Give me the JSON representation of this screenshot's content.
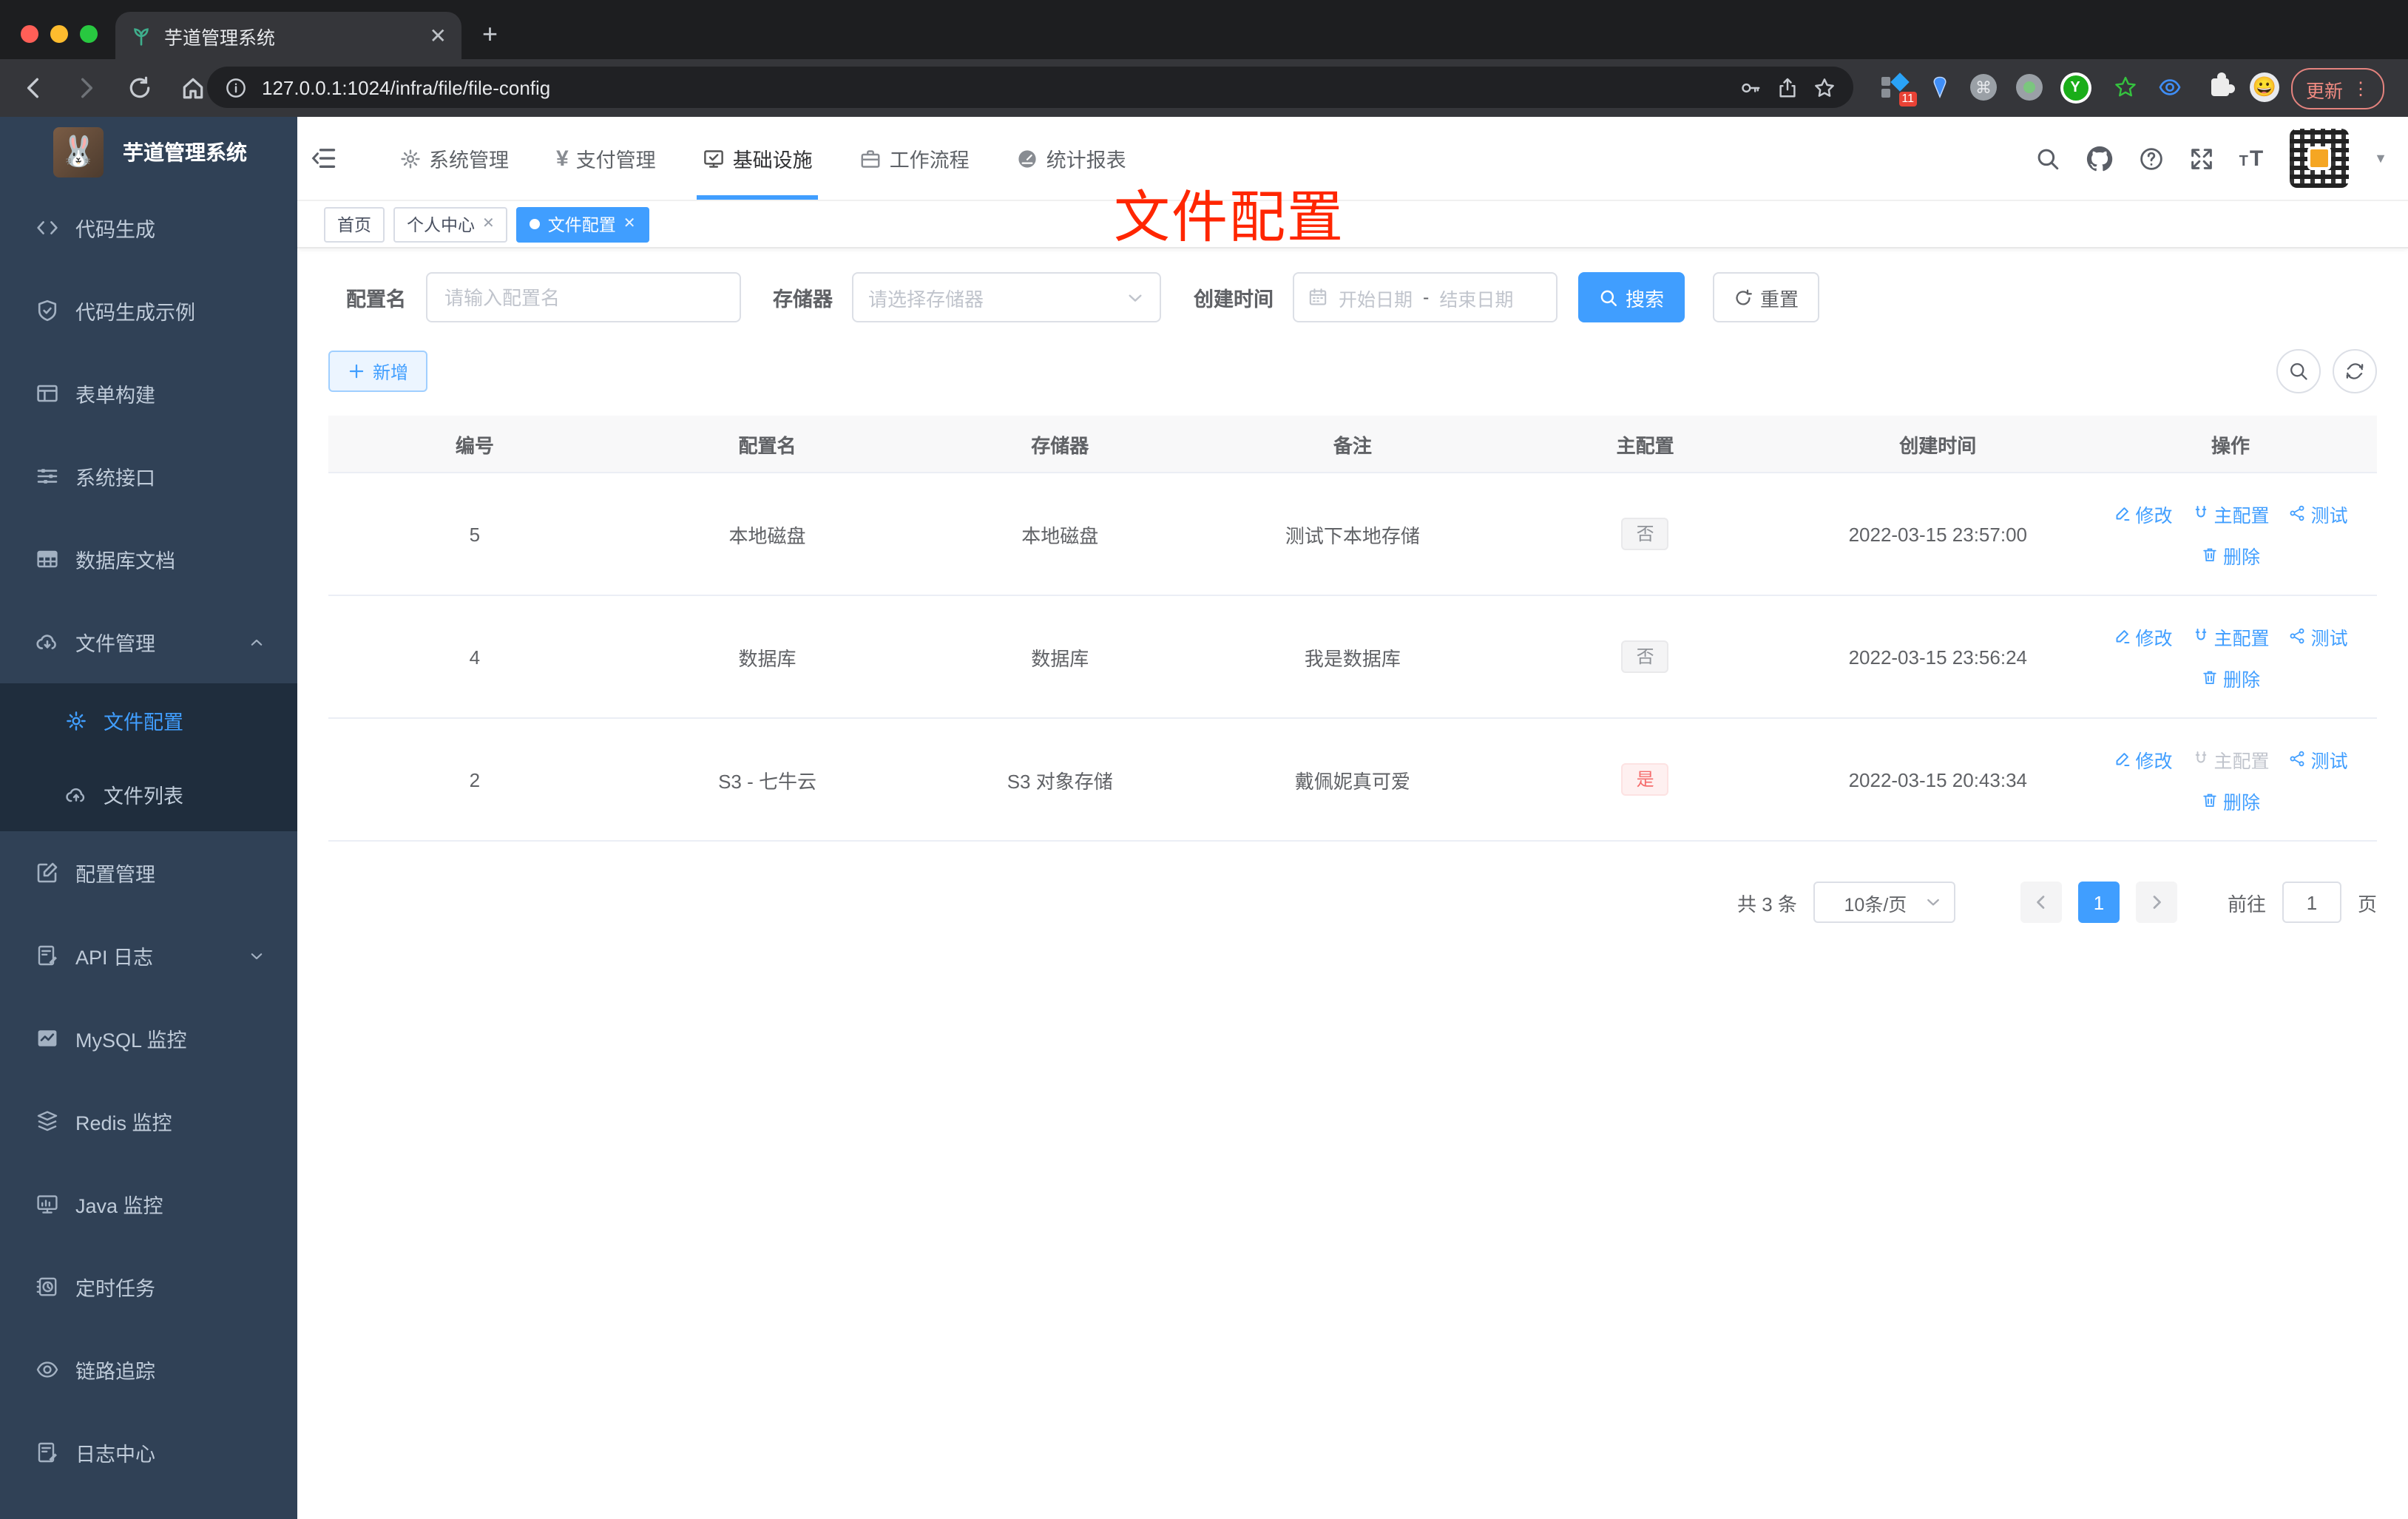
{
  "colors": {
    "accent": "#409eff",
    "danger": "#f56c6c",
    "sidebar_bg": "#304156",
    "sidebar_sub_bg": "#1f2d3d",
    "annotation_red": "#ff2600",
    "tag_active": "#409eff"
  },
  "browser": {
    "tab_title": "芋道管理系统",
    "url": "127.0.0.1:1024/infra/file/file-config",
    "update_label": "更新",
    "extension_badge": "11"
  },
  "sidebar": {
    "app_title": "芋道管理系统",
    "items": [
      {
        "label": "代码生成"
      },
      {
        "label": "代码生成示例"
      },
      {
        "label": "表单构建"
      },
      {
        "label": "系统接口"
      },
      {
        "label": "数据库文档"
      },
      {
        "label": "文件管理"
      },
      {
        "label": "文件配置"
      },
      {
        "label": "文件列表"
      },
      {
        "label": "配置管理"
      },
      {
        "label": "API 日志"
      },
      {
        "label": "MySQL 监控"
      },
      {
        "label": "Redis 监控"
      },
      {
        "label": "Java 监控"
      },
      {
        "label": "定时任务"
      },
      {
        "label": "链路追踪"
      },
      {
        "label": "日志中心"
      }
    ]
  },
  "topnav": {
    "items": [
      {
        "label": "系统管理"
      },
      {
        "label": "支付管理"
      },
      {
        "label": "基础设施"
      },
      {
        "label": "工作流程"
      },
      {
        "label": "统计报表"
      }
    ]
  },
  "tags": [
    {
      "label": "首页"
    },
    {
      "label": "个人中心"
    },
    {
      "label": "文件配置"
    }
  ],
  "annotation": "文件配置",
  "filters": {
    "config_name_label": "配置名",
    "config_name_placeholder": "请输入配置名",
    "storage_label": "存储器",
    "storage_placeholder": "请选择存储器",
    "create_time_label": "创建时间",
    "start_placeholder": "开始日期",
    "range_separator": "-",
    "end_placeholder": "结束日期",
    "search_label": "搜索",
    "reset_label": "重置"
  },
  "toolbar": {
    "add_label": "新增"
  },
  "table": {
    "columns": [
      "编号",
      "配置名",
      "存储器",
      "备注",
      "主配置",
      "创建时间",
      "操作"
    ],
    "actions": {
      "edit": "修改",
      "master": "主配置",
      "test": "测试",
      "del": "删除"
    },
    "rows": [
      {
        "id": "5",
        "name": "本地磁盘",
        "storage": "本地磁盘",
        "remark": "测试下本地存储",
        "master": "否",
        "time": "2022-03-15 23:57:00"
      },
      {
        "id": "4",
        "name": "数据库",
        "storage": "数据库",
        "remark": "我是数据库",
        "master": "否",
        "time": "2022-03-15 23:56:24"
      },
      {
        "id": "2",
        "name": "S3 - 七牛云",
        "storage": "S3 对象存储",
        "remark": "戴佩妮真可爱",
        "master": "是",
        "time": "2022-03-15 20:43:34"
      }
    ]
  },
  "pagination": {
    "total": "共 3 条",
    "page_size": "10条/页",
    "current": "1",
    "goto_label": "前往",
    "goto_value": "1",
    "page_unit": "页"
  }
}
